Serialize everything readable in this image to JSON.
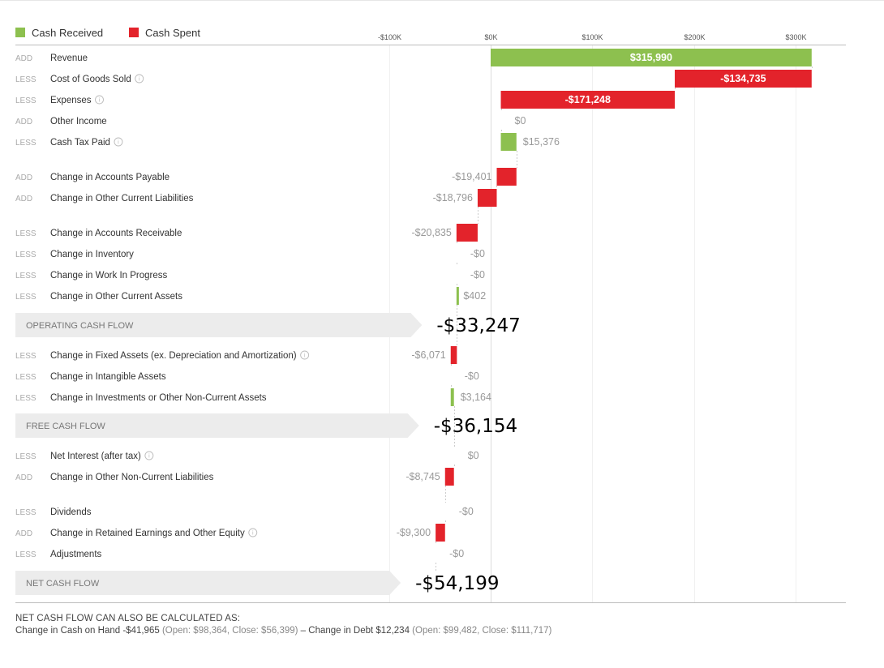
{
  "legend": [
    {
      "label": "Cash Received",
      "color": "#8dc04f"
    },
    {
      "label": "Cash Spent",
      "color": "#e3232b"
    }
  ],
  "chart_data": {
    "type": "waterfall",
    "x_ticks": [
      {
        "value": -100000,
        "label": "-$100K"
      },
      {
        "value": 0,
        "label": "$0K"
      },
      {
        "value": 100000,
        "label": "$100K"
      },
      {
        "value": 200000,
        "label": "$200K"
      },
      {
        "value": 300000,
        "label": "$300K"
      }
    ],
    "rows": [
      {
        "kind": "item",
        "type": "ADD",
        "name": "Revenue",
        "info": false,
        "value": 315990,
        "label": "$315,990",
        "end": 315990
      },
      {
        "kind": "item",
        "type": "LESS",
        "name": "Cost of Goods Sold",
        "info": true,
        "value": -134735,
        "label": "-$134,735",
        "end": 181255
      },
      {
        "kind": "item",
        "type": "LESS",
        "name": "Expenses",
        "info": true,
        "value": -171248,
        "label": "-$171,248",
        "end": 10007
      },
      {
        "kind": "item",
        "type": "ADD",
        "name": "Other Income",
        "info": false,
        "value": 0,
        "label": "$0",
        "end": 10007
      },
      {
        "kind": "item",
        "type": "LESS",
        "name": "Cash Tax Paid",
        "info": true,
        "value": 15376,
        "label": "$15,376",
        "end": 25383
      },
      {
        "kind": "item",
        "type": "ADD",
        "name": "Change in Accounts Payable",
        "info": false,
        "value": -19401,
        "label": "-$19,401",
        "end": 5982
      },
      {
        "kind": "item",
        "type": "ADD",
        "name": "Change in Other Current Liabilities",
        "info": false,
        "value": -18796,
        "label": "-$18,796",
        "end": -12814
      },
      {
        "kind": "item",
        "type": "LESS",
        "name": "Change in Accounts Receivable",
        "info": false,
        "value": -20835,
        "label": "-$20,835",
        "end": -33649
      },
      {
        "kind": "item",
        "type": "LESS",
        "name": "Change in Inventory",
        "info": false,
        "value": 0,
        "label": "-$0",
        "end": -33649
      },
      {
        "kind": "item",
        "type": "LESS",
        "name": "Change in Work In Progress",
        "info": false,
        "value": 0,
        "label": "-$0",
        "end": -33649
      },
      {
        "kind": "item",
        "type": "LESS",
        "name": "Change in Other Current Assets",
        "info": false,
        "value": 402,
        "label": "$402",
        "end": -33247
      },
      {
        "kind": "subtotal",
        "name": "OPERATING CASH FLOW",
        "value": -33247,
        "label": "-$33,247"
      },
      {
        "kind": "item",
        "type": "LESS",
        "name": "Change in Fixed Assets (ex. Depreciation and Amortization)",
        "info": true,
        "value": -6071,
        "label": "-$6,071",
        "end": -39318
      },
      {
        "kind": "item",
        "type": "LESS",
        "name": "Change in Intangible Assets",
        "info": false,
        "value": 0,
        "label": "-$0",
        "end": -39318
      },
      {
        "kind": "item",
        "type": "LESS",
        "name": "Change in Investments or Other Non-Current Assets",
        "info": false,
        "value": 3164,
        "label": "$3,164",
        "end": -36154
      },
      {
        "kind": "subtotal",
        "name": "FREE CASH FLOW",
        "value": -36154,
        "label": "-$36,154"
      },
      {
        "kind": "item",
        "type": "LESS",
        "name": "Net Interest (after tax)",
        "info": true,
        "value": 0,
        "label": "$0",
        "end": -36154
      },
      {
        "kind": "item",
        "type": "ADD",
        "name": "Change in Other Non-Current Liabilities",
        "info": false,
        "value": -8745,
        "label": "-$8,745",
        "end": -44899
      },
      {
        "kind": "item",
        "type": "LESS",
        "name": "Dividends",
        "info": false,
        "value": 0,
        "label": "-$0",
        "end": -44899
      },
      {
        "kind": "item",
        "type": "ADD",
        "name": "Change in Retained Earnings and Other Equity",
        "info": true,
        "value": -9300,
        "label": "-$9,300",
        "end": -54199
      },
      {
        "kind": "item",
        "type": "LESS",
        "name": "Adjustments",
        "info": false,
        "value": 0,
        "label": "-$0",
        "end": -54199
      },
      {
        "kind": "subtotal",
        "name": "NET CASH FLOW",
        "value": -54199,
        "label": "-$54,199"
      }
    ]
  },
  "footer": {
    "heading": "NET CASH FLOW CAN ALSO BE CALCULATED AS:",
    "cash_label": "Change in Cash on Hand -$41,965",
    "cash_detail": "(Open: $98,364, Close: $56,399)",
    "separator": "–",
    "debt_label": "Change in Debt $12,234",
    "debt_detail": "(Open: $99,482, Close: $111,717)"
  }
}
